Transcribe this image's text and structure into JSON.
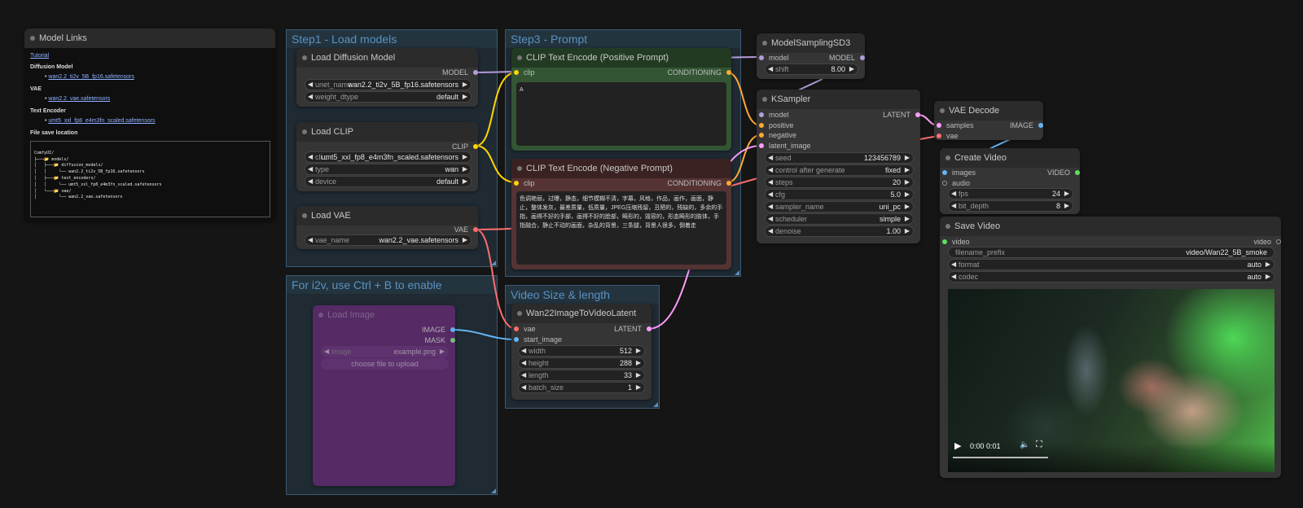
{
  "colors": {
    "canvas": "#151515",
    "group_title": "#5a91c0",
    "positive_node": "#335533",
    "negative_node": "#553333",
    "wire_model": "#b39ddb",
    "wire_clip": "#ffd500",
    "wire_conditioning": "#ffa931",
    "wire_latent": "#ff9cf9",
    "wire_vae": "#ff6e6e",
    "wire_image": "#64b5f6",
    "wire_video": "#5ee05e"
  },
  "model_links": {
    "title": "Model Links",
    "tutorial": "Tutorial",
    "diffusion_heading": "Diffusion Model",
    "diffusion_file": "wan2.2_ti2v_5B_fp16.safetensors",
    "vae_heading": "VAE",
    "vae_file": "wan2.2_vae.safetensors",
    "text_encoder_heading": "Text Encoder",
    "text_encoder_file": "umt5_xxl_fp8_e4m3fn_scaled.safetensors",
    "save_location_heading": "File save location",
    "tree": [
      "ComfyUI/",
      "├───📂 models/",
      "│   ├───📂 diffusion_models/",
      "│   │     └── wan2.2_ti2v_5B_fp16.safetensors",
      "│   ├───📂 text_encoders/",
      "│   │     └── umt5_xxl_fp8_e4m3fn_scaled.safetensors",
      "│   └───📂 vae/",
      "│         └── wan2.2_vae.safetensors"
    ]
  },
  "groups": {
    "step1": "Step1 - Load models",
    "step3": "Step3 - Prompt",
    "i2v": "For i2v, use Ctrl + B to enable",
    "video_size": "Video Size & length"
  },
  "load_diffusion": {
    "title": "Load Diffusion Model",
    "out_model": "MODEL",
    "unet_label": "unet_name",
    "unet_value": "wan2.2_ti2v_5B_fp16.safetensors",
    "dtype_label": "weight_dtype",
    "dtype_value": "default"
  },
  "load_clip": {
    "title": "Load CLIP",
    "out_clip": "CLIP",
    "clip_label": "cli...",
    "clip_value": "umt5_xxl_fp8_e4m3fn_scaled.safetensors",
    "type_label": "type",
    "type_value": "wan",
    "device_label": "device",
    "device_value": "default"
  },
  "load_vae": {
    "title": "Load VAE",
    "out_vae": "VAE",
    "name_label": "vae_name",
    "name_value": "wan2.2_vae.safetensors"
  },
  "load_image": {
    "title": "Load Image",
    "out_image": "IMAGE",
    "out_mask": "MASK",
    "image_label": "image",
    "image_value": "example.png",
    "upload": "choose file to upload"
  },
  "positive": {
    "title": "CLIP Text Encode (Positive Prompt)",
    "in_clip": "clip",
    "out_cond": "CONDITIONING",
    "text": "A"
  },
  "negative": {
    "title": "CLIP Text Encode (Negative Prompt)",
    "in_clip": "clip",
    "out_cond": "CONDITIONING",
    "text": "色调艳丽，过曝，静态，细节模糊不清，字幕，风格，作品，画作，画面，静止，整体发灰，最差质量，低质量，JPEG压缩残留，丑陋的，残缺的，多余的手指，画得不好的手部，画得不好的脸部，畸形的，毁容的，形态畸形的肢体，手指融合，静止不动的画面，杂乱的背景，三条腿，背景人很多，倒着走"
  },
  "wan22": {
    "title": "Wan22ImageToVideoLatent",
    "in_vae": "vae",
    "in_start": "start_image",
    "out_latent": "LATENT",
    "width_label": "width",
    "width_value": "512",
    "height_label": "height",
    "height_value": "288",
    "length_label": "length",
    "length_value": "33",
    "batch_label": "batch_size",
    "batch_value": "1"
  },
  "model_sampling": {
    "title": "ModelSamplingSD3",
    "in_model": "model",
    "out_model": "MODEL",
    "shift_label": "shift",
    "shift_value": "8.00"
  },
  "ksampler": {
    "title": "KSampler",
    "in_model": "model",
    "in_positive": "positive",
    "in_negative": "negative",
    "in_latent": "latent_image",
    "out_latent": "LATENT",
    "seed_label": "seed",
    "seed_value": "123456789",
    "cag_label": "control after generate",
    "cag_value": "fixed",
    "steps_label": "steps",
    "steps_value": "20",
    "cfg_label": "cfg",
    "cfg_value": "5.0",
    "sampler_label": "sampler_name",
    "sampler_value": "uni_pc",
    "scheduler_label": "scheduler",
    "scheduler_value": "simple",
    "denoise_label": "denoise",
    "denoise_value": "1.00"
  },
  "vae_decode": {
    "title": "VAE Decode",
    "in_samples": "samples",
    "in_vae": "vae",
    "out_image": "IMAGE"
  },
  "create_video": {
    "title": "Create Video",
    "in_images": "images",
    "in_audio": "audio",
    "out_video": "VIDEO",
    "fps_label": "fps",
    "fps_value": "24",
    "bit_label": "bit_depth",
    "bit_value": "8"
  },
  "save_video": {
    "title": "Save Video",
    "in_video": "video",
    "out_video": "video",
    "prefix_label": "filename_prefix",
    "prefix_value": "video/Wan22_5B_smoke",
    "format_label": "format",
    "format_value": "auto",
    "codec_label": "codec",
    "codec_value": "auto",
    "player_time": "0:00 0:01",
    "play_icon": "play-icon",
    "volume_icon": "volume-icon",
    "fullscreen_icon": "fullscreen-icon"
  }
}
